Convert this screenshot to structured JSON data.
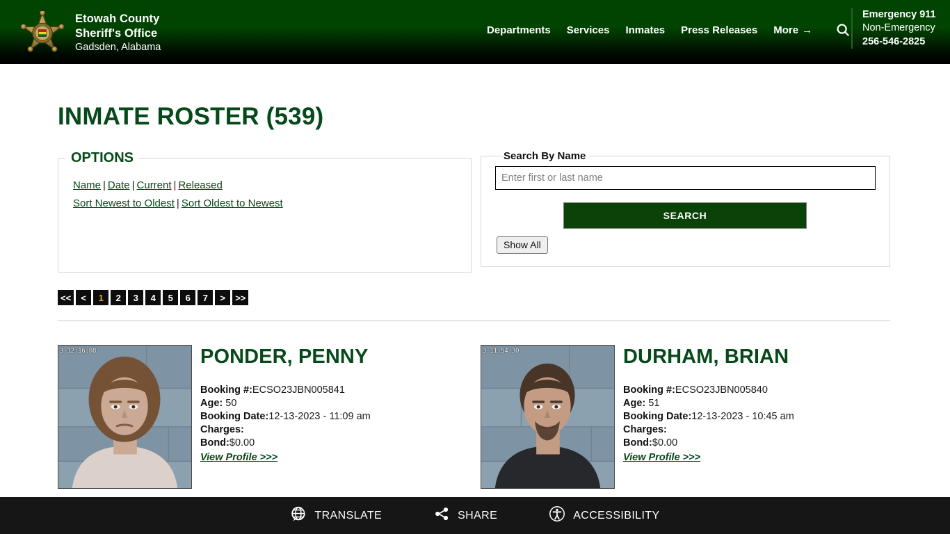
{
  "header": {
    "brand": {
      "line1": "Etowah County",
      "line2": "Sheriff's Office",
      "line3": "Gadsden, Alabama",
      "badge_icon": "sheriff-star-badge-icon"
    },
    "nav": [
      {
        "label": "Departments"
      },
      {
        "label": "Services"
      },
      {
        "label": "Inmates"
      },
      {
        "label": "Press Releases"
      },
      {
        "label": "More",
        "arrow": "→"
      }
    ],
    "search_icon": "search-icon",
    "emergency": {
      "emergency_label": "Emergency 911",
      "non_emergency_label": "Non-Emergency",
      "non_emergency_phone": "256-546-2825"
    },
    "colors": {
      "header_top": "#014401",
      "header_bottom": "#000000"
    }
  },
  "main": {
    "page_title": "INMATE ROSTER (539)",
    "options": {
      "legend": "OPTIONS",
      "filters": [
        {
          "label": "Name"
        },
        {
          "label": "Date"
        },
        {
          "label": "Current"
        },
        {
          "label": "Released"
        }
      ],
      "separator": "|",
      "sorts": [
        {
          "label": "Sort Newest to Oldest"
        },
        {
          "label": "Sort Oldest to Newest"
        }
      ]
    },
    "search": {
      "legend": "Search By Name",
      "input_value": "",
      "placeholder": "Enter first or last name",
      "submit_label": "SEARCH",
      "show_all_label": "Show All",
      "accent_color": "#0b4208"
    },
    "pagination": {
      "current_page": "1",
      "items": [
        {
          "label": "<<",
          "current": false
        },
        {
          "label": "<",
          "current": false
        },
        {
          "label": "1",
          "current": true
        },
        {
          "label": "2",
          "current": false
        },
        {
          "label": "3",
          "current": false
        },
        {
          "label": "4",
          "current": false
        },
        {
          "label": "5",
          "current": false
        },
        {
          "label": "6",
          "current": false
        },
        {
          "label": "7",
          "current": false
        },
        {
          "label": ">",
          "current": false
        },
        {
          "label": ">>",
          "current": false
        }
      ],
      "current_color": "#e8a31b"
    },
    "labels": {
      "booking_number": "Booking #:",
      "age": "Age:",
      "booking_date": "Booking Date:",
      "charges": "Charges:",
      "bond": "Bond:",
      "view_profile": "View Profile >>>"
    },
    "inmates": [
      {
        "name": "PONDER, PENNY",
        "booking_number": "ECSO23JBN005841",
        "age": "50",
        "booking_date": "12-13-2023 - 11:09 am",
        "charges": "",
        "bond": "$0.00",
        "mugshot_stamp": "3  12:16:08",
        "mugshot_alt": "mugshot-penny-ponder"
      },
      {
        "name": "DURHAM, BRIAN",
        "booking_number": "ECSO23JBN005840",
        "age": "51",
        "booking_date": "12-13-2023 - 10:45 am",
        "charges": "",
        "bond": "$0.00",
        "mugshot_stamp": "3  11:54:30",
        "mugshot_alt": "mugshot-brian-durham"
      }
    ]
  },
  "bottom_bar": {
    "items": [
      {
        "label": "TRANSLATE",
        "icon": "globe-speech-icon"
      },
      {
        "label": "SHARE",
        "icon": "share-nodes-icon"
      },
      {
        "label": "ACCESSIBILITY",
        "icon": "accessibility-person-icon"
      }
    ]
  }
}
